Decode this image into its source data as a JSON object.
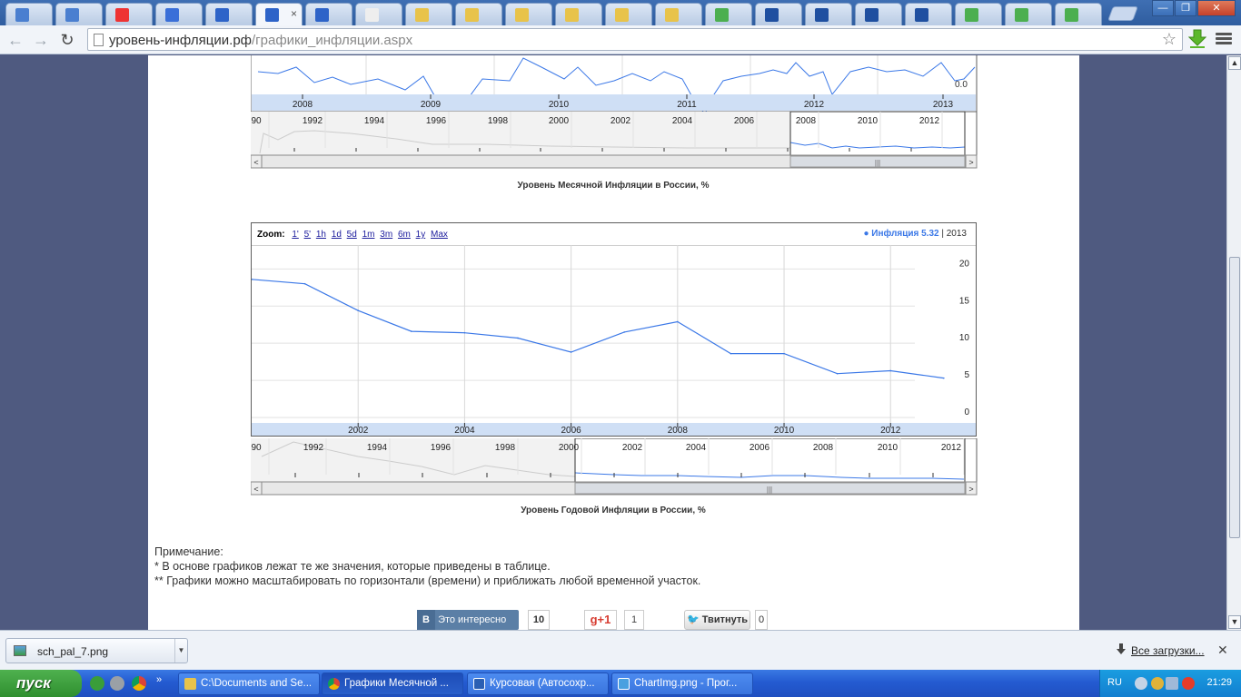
{
  "browser": {
    "tabs_count": 22,
    "active_tab_close": "×",
    "window_buttons": {
      "minimize": "—",
      "restore": "❐",
      "close": "✕"
    },
    "url_host": "уровень-инфляции.рф",
    "url_path": "/графики_инфляции.aspx",
    "nav": {
      "back": "←",
      "forward": "→",
      "reload": "↻",
      "star": "☆"
    }
  },
  "monthly_chart": {
    "top_axis_labels": [
      "2008",
      "2009",
      "2010",
      "2011",
      "2012",
      "2013"
    ],
    "y_tick_visible": [
      "0.0"
    ],
    "nav_axis_labels": [
      "90",
      "1992",
      "1994",
      "1996",
      "1998",
      "2000",
      "2002",
      "2004",
      "2006",
      "2008",
      "2010",
      "2012"
    ],
    "caption": "Уровень Месячной Инфляции в России, %"
  },
  "annual_chart": {
    "zoom_label": "Zoom:",
    "zoom_options": [
      "1'",
      "5'",
      "1h",
      "1d",
      "5d",
      "1m",
      "3m",
      "6m",
      "1y",
      "Max"
    ],
    "legend_series": "Инфляция 5.32",
    "legend_year": "2013",
    "nav_axis_labels": [
      "90",
      "1992",
      "1994",
      "1996",
      "1998",
      "2000",
      "2002",
      "2004",
      "2006",
      "2008",
      "2010",
      "2012"
    ],
    "caption": "Уровень Годовой Инфляции в России, %"
  },
  "chart_data": [
    {
      "type": "line",
      "title": "Уровень Годовой Инфляции в России, %",
      "series": [
        {
          "name": "Инфляция",
          "color": "#3b78e7",
          "x": [
            2000,
            2001,
            2002,
            2003,
            2004,
            2005,
            2006,
            2007,
            2008,
            2009,
            2010,
            2011,
            2012,
            2013
          ],
          "values": [
            18.6,
            18.0,
            14.4,
            11.6,
            11.4,
            10.7,
            8.8,
            11.5,
            12.9,
            8.6,
            8.6,
            5.9,
            6.3,
            5.3
          ]
        }
      ],
      "x_ticks": [
        2002,
        2004,
        2006,
        2008,
        2010,
        2012
      ],
      "y_ticks": [
        0,
        5,
        10,
        15,
        20
      ],
      "xlim": [
        2000,
        2013.6
      ],
      "ylim": [
        0,
        22
      ],
      "grid": true,
      "legend": "top-right"
    }
  ],
  "notes": {
    "title": "Примечание:",
    "line1": "* В основе графиков лежат те же значения, которые приведены в таблице.",
    "line2": "** Графики можно масштабировать по горизонтали (времени) и приближать любой временной участок."
  },
  "share": {
    "vk_label": "Это интересно",
    "vk_letter": "В",
    "vk_count": "10",
    "gplus_label": "g+1",
    "gplus_count": "1",
    "twitter_label": "Твитнуть",
    "twitter_count": "0"
  },
  "download_shelf": {
    "file_name": "sch_pal_7.png",
    "all_downloads": "Все загрузки...",
    "close": "✕"
  },
  "taskbar": {
    "start_label": "пуск",
    "tasks": [
      {
        "label": "C:\\Documents and Se...",
        "color": "#e8c34a"
      },
      {
        "label": "Графики Месячной ...",
        "color": "#e04a3a",
        "active": true
      },
      {
        "label": "Курсовая (Автосохр...",
        "color": "#2b5fb3"
      },
      {
        "label": "ChartImg.png - Прог...",
        "color": "#4aa0e0"
      }
    ],
    "language": "RU",
    "clock": "21:29"
  }
}
